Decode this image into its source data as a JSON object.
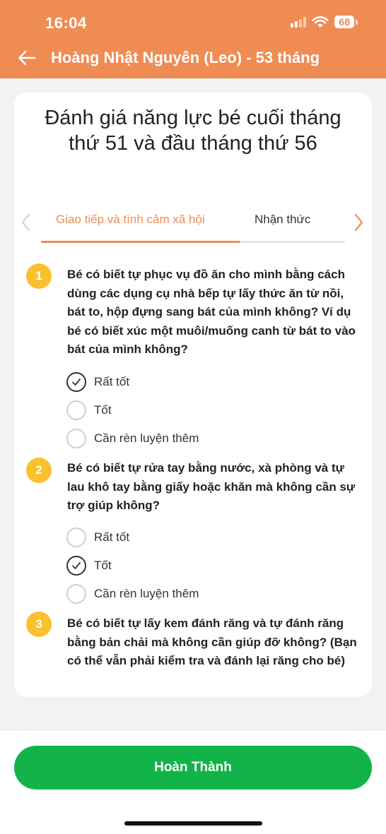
{
  "status_bar": {
    "time": "16:04",
    "battery": "68"
  },
  "header": {
    "title": "Hoàng Nhật Nguyên (Leo) - 53 tháng"
  },
  "card": {
    "title": "Đánh giá năng lực bé cuối tháng thứ 51 và đầu tháng thứ 56"
  },
  "tabs": [
    {
      "label": "Giao tiếp và tình cảm xã hội",
      "active": true
    },
    {
      "label": "Nhận thức",
      "active": false
    }
  ],
  "questions": [
    {
      "number": "1",
      "text": "Bé có biết tự phục vụ đồ ăn cho mình bằng cách dùng các dụng cụ nhà bếp tự lấy thức ăn từ nồi, bát to, hộp đựng sang bát của mình không? Ví dụ bé có biết xúc một muôi/muống canh từ bát to vào bát của mình không?",
      "options": [
        "Rất tốt",
        "Tốt",
        "Cần rèn luyện thêm"
      ],
      "selected": "Rất tốt"
    },
    {
      "number": "2",
      "text": "Bé có biết tự rửa tay bằng nước, xà phòng và tự lau khô tay bằng giấy hoặc khăn mà không cần sự trợ giúp không?",
      "options": [
        "Rất tốt",
        "Tốt",
        "Cần rèn luyện thêm"
      ],
      "selected": "Tốt"
    },
    {
      "number": "3",
      "text": "Bé có biết tự lấy kem đánh răng và tự đánh răng bằng bản chải mà không cần giúp đỡ không? (Bạn có thể vẫn phải kiểm tra và đánh lại răng cho bé)"
    }
  ],
  "footer": {
    "button_label": "Hoàn Thành"
  },
  "colors": {
    "header": "#ef8c54",
    "accent": "#ef8c54",
    "badge": "#f9c12e",
    "button": "#12b449"
  },
  "icons": {
    "back": "arrow-left-icon",
    "prev": "chevron-left-icon",
    "next": "chevron-right-icon",
    "check": "check-icon"
  }
}
